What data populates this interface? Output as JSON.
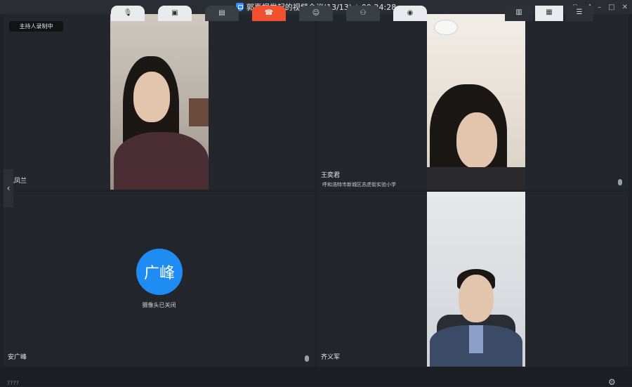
{
  "window": {
    "title": "郭喜桐发起的视频会议(13/13)",
    "separator": "|",
    "timer": "00:24:28"
  },
  "tiles": [
    {
      "name": "包凤兰",
      "recording_badge": "主持人录制中"
    },
    {
      "name": "王奕君",
      "subtitle": "呼和浩特市新城区苏虎街实验小学"
    },
    {
      "name": "安广峰",
      "avatar_text": "广峰",
      "camera_status": "摄像头已关闭"
    },
    {
      "name": "齐义军"
    }
  ],
  "colors": {
    "avatar": "#1e8cf2",
    "hangup": "#f25130",
    "accent": "#2f8cff"
  },
  "toolbar": {
    "icons": [
      "mic-muted-icon",
      "camera-off-icon",
      "share-screen-icon",
      "hangup-icon",
      "participants-icon",
      "invite-icon",
      "record-icon"
    ],
    "layout_icons": [
      "sidebar-layout-icon",
      "grid-layout-icon",
      "list-layout-icon",
      "gear-icon"
    ]
  },
  "bottom_left": "????"
}
